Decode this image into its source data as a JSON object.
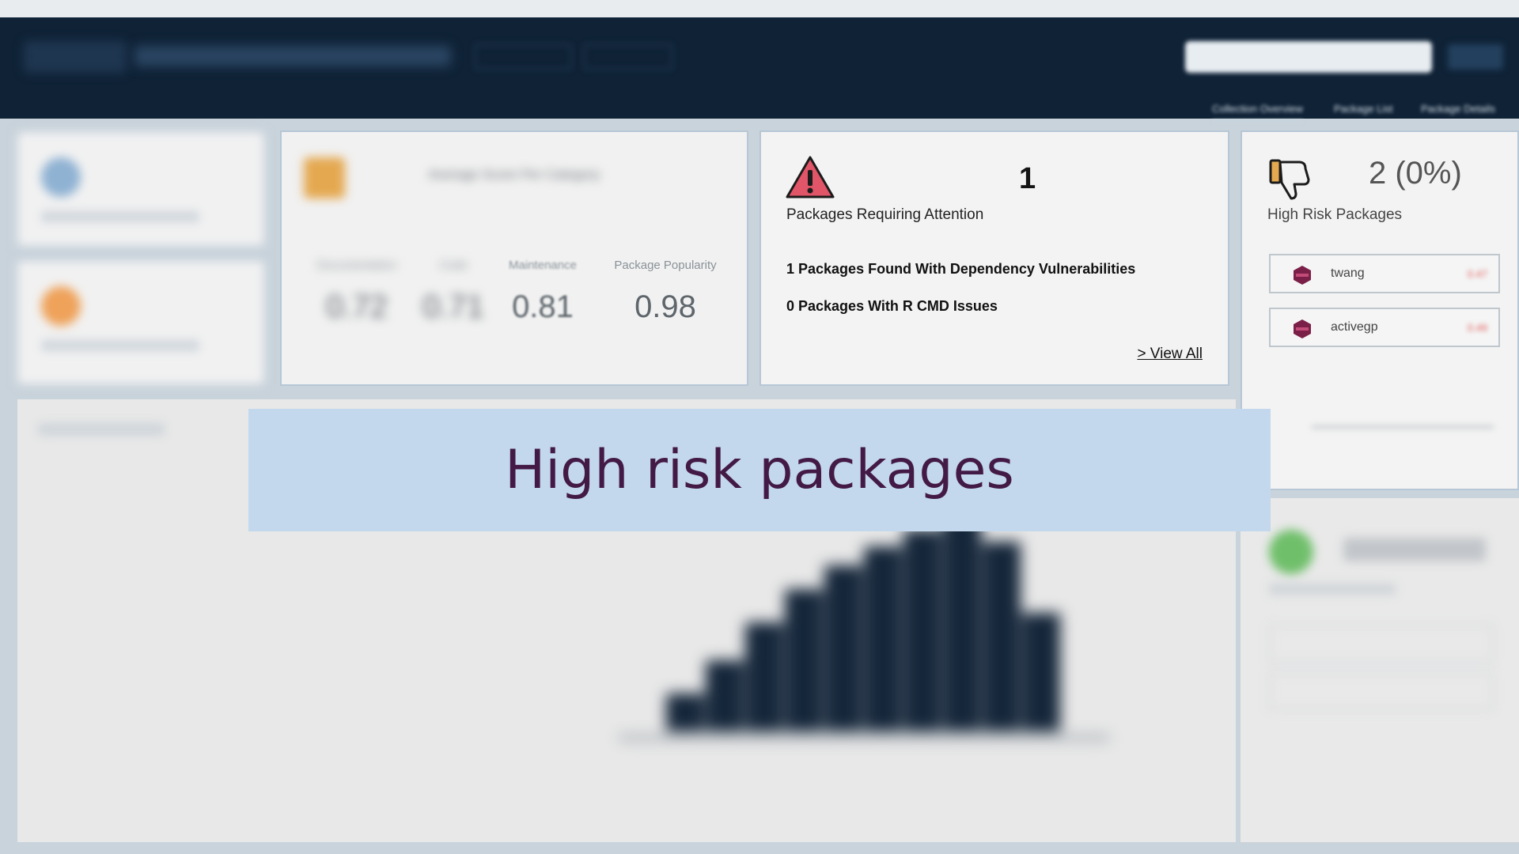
{
  "header": {
    "nav_items": [
      "Collection Overview",
      "Package List",
      "Package Details"
    ]
  },
  "score_tile": {
    "title": "Average Score Per Category",
    "categories": [
      {
        "label": "Documentation",
        "value": "0.72"
      },
      {
        "label": "Code",
        "value": "0.71"
      },
      {
        "label": "Maintenance",
        "value": "0.81"
      },
      {
        "label": "Package Popularity",
        "value": "0.98"
      }
    ]
  },
  "attention_tile": {
    "count": "1",
    "label": "Packages Requiring Attention",
    "line1": "1 Packages Found With Dependency Vulnerabilities",
    "line2": "0 Packages With R CMD Issues",
    "view_all": "> View All"
  },
  "risk_tile": {
    "count": "2 (0%)",
    "label": "High Risk Packages",
    "packages": [
      {
        "name": "twang",
        "score": "0.47"
      },
      {
        "name": "activegp",
        "score": "0.49"
      }
    ]
  },
  "chart_data": {
    "type": "bar",
    "values": [
      0.16,
      0.3,
      0.46,
      0.6,
      0.7,
      0.78,
      0.85,
      1.0,
      0.8,
      0.5
    ]
  },
  "banner": {
    "text": "High risk packages"
  },
  "colors": {
    "header": "#0f2236",
    "banner": "#c3d8ec",
    "banner_text": "#431a45",
    "warning": "#e05567",
    "accent": "#e4a850"
  }
}
